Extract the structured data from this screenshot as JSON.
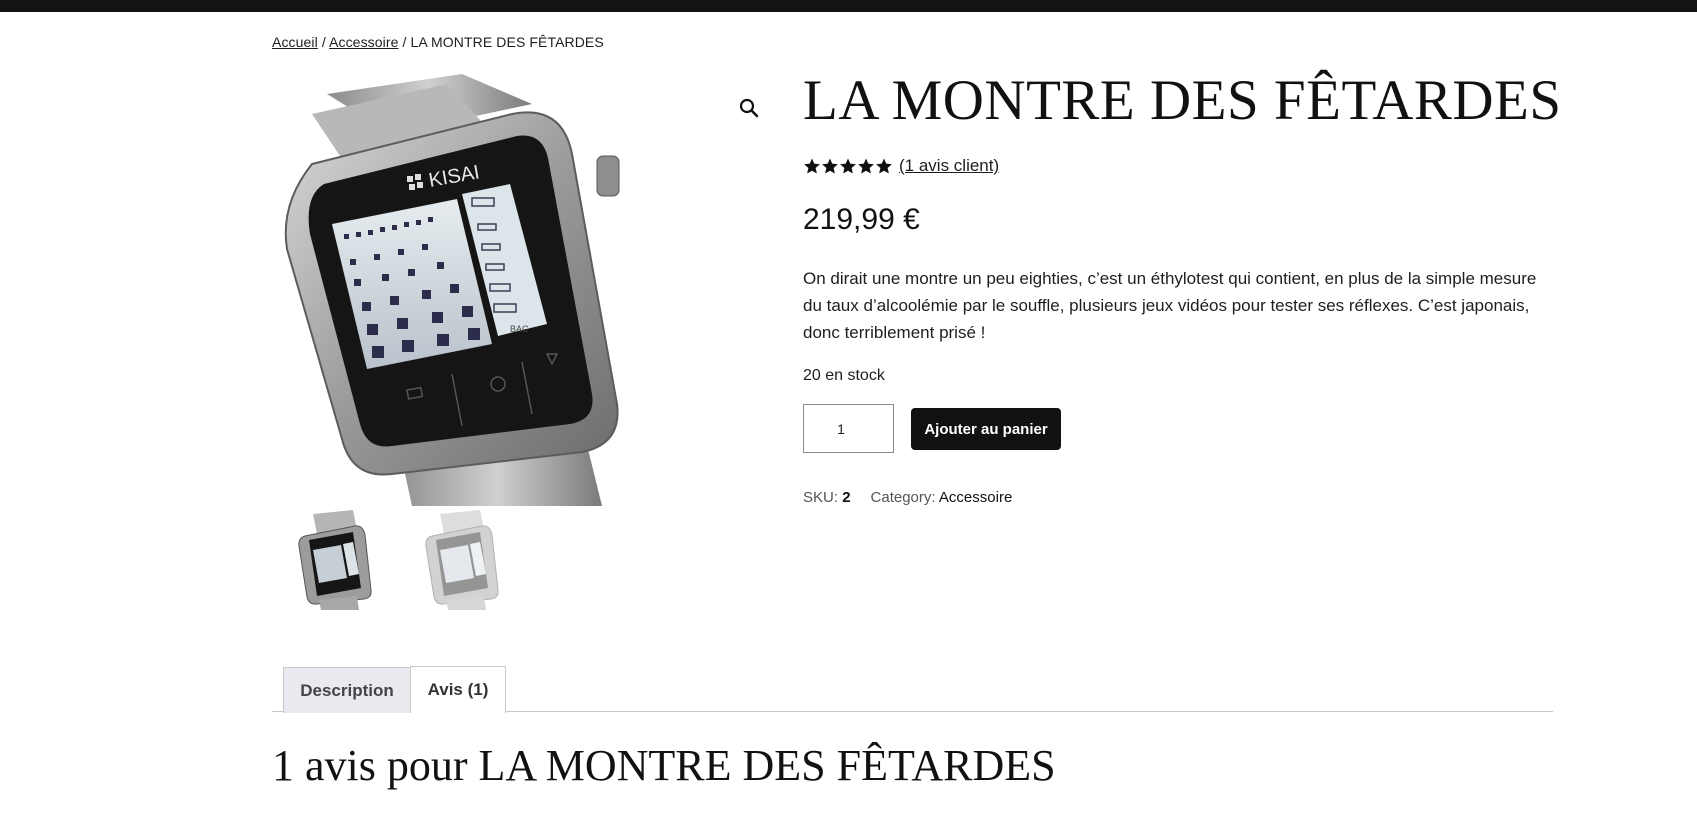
{
  "breadcrumb": {
    "home": "Accueil",
    "separator": " / ",
    "category": "Accessoire",
    "current": "LA MONTRE DES FÊTARDES"
  },
  "gallery": {
    "main_image": "digital watch breathalyzer (KISAI)",
    "watch_brand": "KISAI",
    "watch_label": "BAC",
    "zoom_icon": "magnifier-icon",
    "thumbnails": [
      "watch-thumbnail-1",
      "watch-thumbnail-2"
    ]
  },
  "product": {
    "title": "LA MONTRE DES FÊTARDES",
    "rating_value": 5,
    "rating_max": 5,
    "review_link": "(1 avis client)",
    "price": "219,99 €",
    "description": "On dirait une montre un peu eighties, c’est un éthylotest qui contient, en plus de la simple mesure du taux d’alcoolémie par le souffle, plusieurs jeux vidéos pour tester ses réflexes. C’est japonais, donc terriblement prisé !",
    "stock": "20 en stock",
    "quantity": "1",
    "add_to_cart": "Ajouter au panier",
    "sku_label": "SKU:",
    "sku_value": "2",
    "category_label": "Category:",
    "category_value": "Accessoire"
  },
  "tabs": [
    {
      "label": "Description",
      "active": false
    },
    {
      "label": "Avis (1)",
      "active": true
    }
  ],
  "reviews": {
    "title": "1 avis pour LA MONTRE DES FÊTARDES"
  },
  "colors": {
    "topbar": "#141414",
    "button_bg": "#111111",
    "tab_inactive_bg": "#ebe8ef",
    "text": "#1e1e1e"
  }
}
